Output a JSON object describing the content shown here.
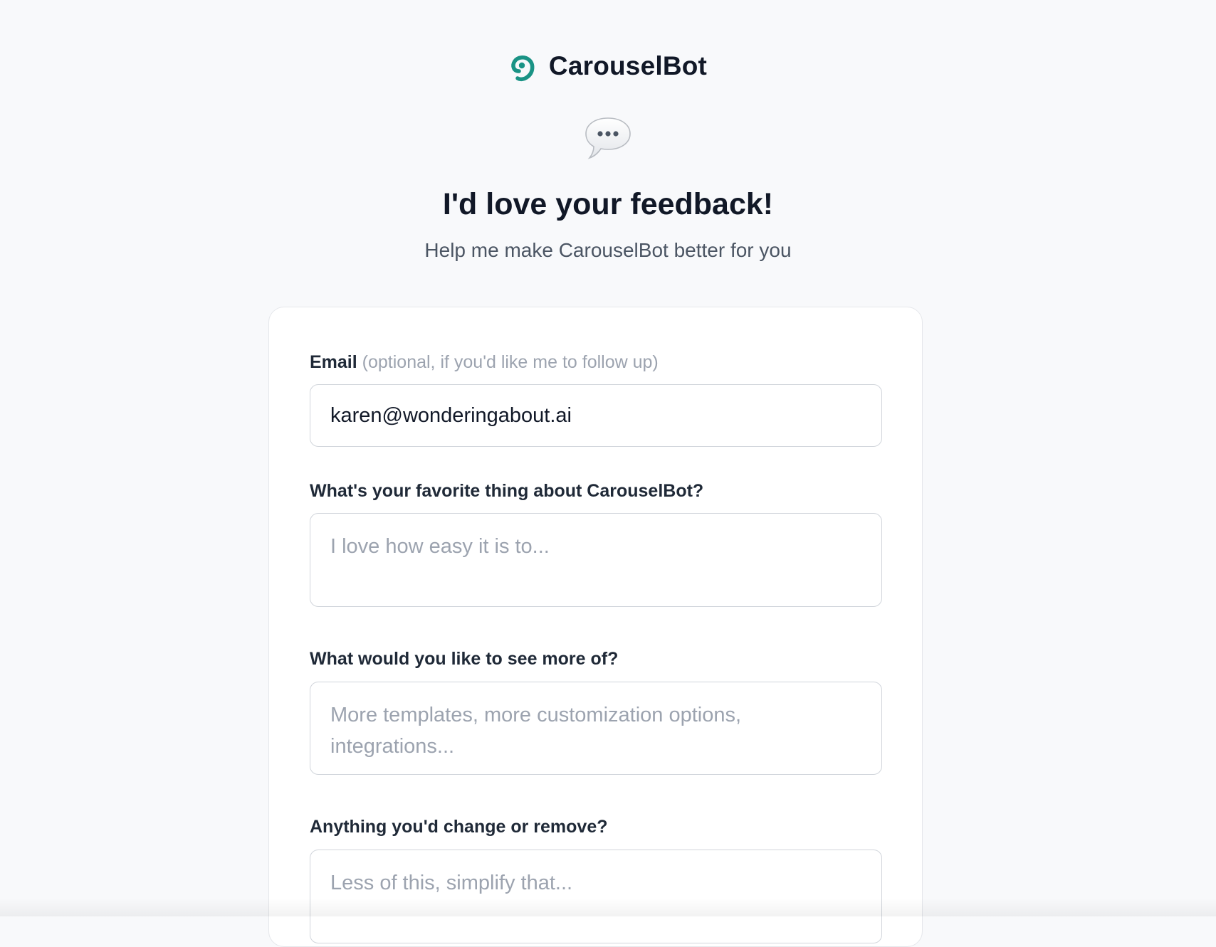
{
  "brand": {
    "name": "CarouselBot",
    "accent_color": "#1a9385",
    "logo_icon": "swirl-logo-icon"
  },
  "hero": {
    "icon": "speech-bubble-icon",
    "title": "I'd love your feedback!",
    "subtitle": "Help me make CarouselBot better for you"
  },
  "form": {
    "email": {
      "label": "Email",
      "hint": "(optional, if you'd like me to follow up)",
      "value": "karen@wonderingabout.ai"
    },
    "favorite": {
      "label": "What's your favorite thing about CarouselBot?",
      "placeholder": "I love how easy it is to..."
    },
    "more_of": {
      "label": "What would you like to see more of?",
      "placeholder": "More templates, more customization options, integrations..."
    },
    "change": {
      "label": "Anything you'd change or remove?",
      "placeholder": "Less of this, simplify that..."
    }
  }
}
